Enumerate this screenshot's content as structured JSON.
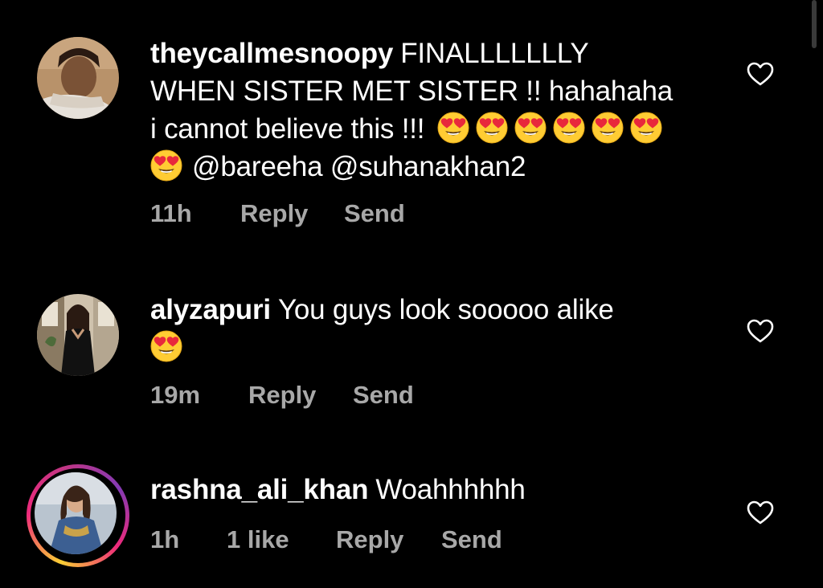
{
  "comments": [
    {
      "username": "theycallmesnoopy",
      "text_line1": "FINALLLLLLLY",
      "text_line2": "WHEN SISTER MET SISTER !! hahahaha",
      "text_line3": "i cannot believe this !!!",
      "text_line4_mentions": "@bareeha @suhanakhan2",
      "emoji": "heart-eyes-emoji",
      "emoji_count": 7,
      "time": "11h",
      "reply_label": "Reply",
      "send_label": "Send",
      "like_icon": "heart-outline-icon"
    },
    {
      "username": "alyzapuri",
      "text_line1": "You guys look sooooo alike",
      "emoji": "heart-eyes-emoji",
      "emoji_count": 1,
      "time": "19m",
      "reply_label": "Reply",
      "send_label": "Send",
      "like_icon": "heart-outline-icon"
    },
    {
      "username": "rashna_ali_khan",
      "text_line1": "Woahhhhhh",
      "time": "1h",
      "likes": "1 like",
      "reply_label": "Reply",
      "send_label": "Send",
      "like_icon": "heart-outline-icon",
      "has_story_ring": true
    }
  ],
  "colors": {
    "background": "#000000",
    "text": "#ffffff",
    "meta_text": "#a8a8a8",
    "emoji_face": "#ffcc33",
    "emoji_heart": "#e8283c"
  }
}
